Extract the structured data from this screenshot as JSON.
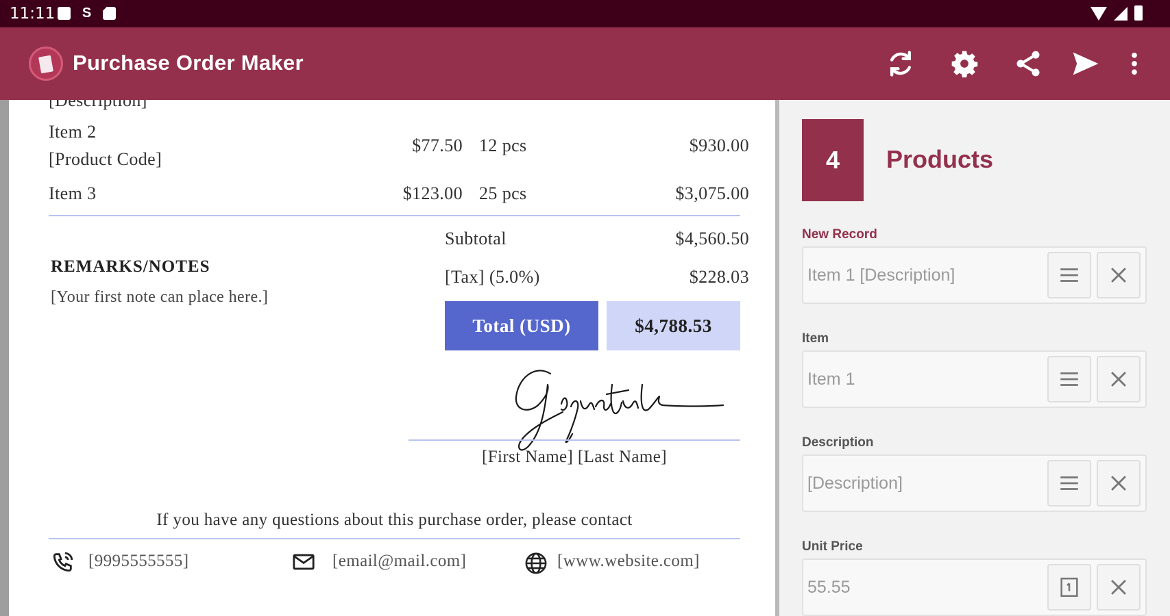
{
  "status_bar": {
    "time": "11:11"
  },
  "app_bar": {
    "title": "Purchase Order Maker"
  },
  "document": {
    "cut_text": "[Description]",
    "items": [
      {
        "name": "Item 2",
        "code": "[Product Code]",
        "unit_price": "$77.50",
        "qty": "12 pcs",
        "total": "$930.00"
      },
      {
        "name": "Item 3",
        "unit_price": "$123.00",
        "qty": "25 pcs",
        "total": "$3,075.00"
      }
    ],
    "remarks_title": "REMARKS/NOTES",
    "remarks_text": "[Your first note can place here.]",
    "subtotal_label": "Subtotal",
    "subtotal_value": "$4,560.50",
    "tax_label": "[Tax] (5.0%)",
    "tax_value": "$228.03",
    "total_label": "Total (USD)",
    "total_value": "$4,788.53",
    "signer_name": "[First Name] [Last Name]",
    "questions_text": "If you have any questions about this purchase order, please contact",
    "contact_phone": "[9995555555]",
    "contact_email": "[email@mail.com]",
    "contact_website": "[www.website.com]"
  },
  "panel": {
    "step_number": "4",
    "step_title": "Products",
    "fields": [
      {
        "label": "New Record",
        "value": "Item 1 [Description]"
      },
      {
        "label": "Item",
        "value": "Item 1"
      },
      {
        "label": "Description",
        "value": "[Description]"
      },
      {
        "label": "Unit Price",
        "value": "55.55"
      }
    ]
  },
  "colors": {
    "primary": "#94304c",
    "status_bar": "#3e0019",
    "total_label_bg": "#5567cc",
    "total_value_bg": "#d0d6f7"
  }
}
